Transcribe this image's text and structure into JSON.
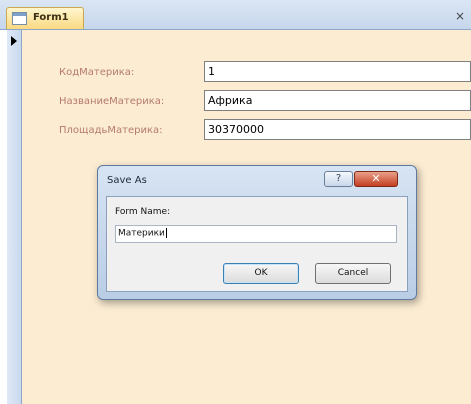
{
  "tab": {
    "title": "Form1",
    "close_glyph": "×"
  },
  "form": {
    "fields": [
      {
        "label": "КодМатерика:",
        "value": "1"
      },
      {
        "label": "НазваниеМатерика:",
        "value": "Африка"
      },
      {
        "label": "ПлощадьМатерика:",
        "value": "30370000"
      }
    ]
  },
  "dialog": {
    "title": "Save As",
    "help_glyph": "?",
    "close_glyph": "✕",
    "form_name_label": "Form Name:",
    "form_name_value": "Материки",
    "ok_label": "OK",
    "cancel_label": "Cancel"
  }
}
